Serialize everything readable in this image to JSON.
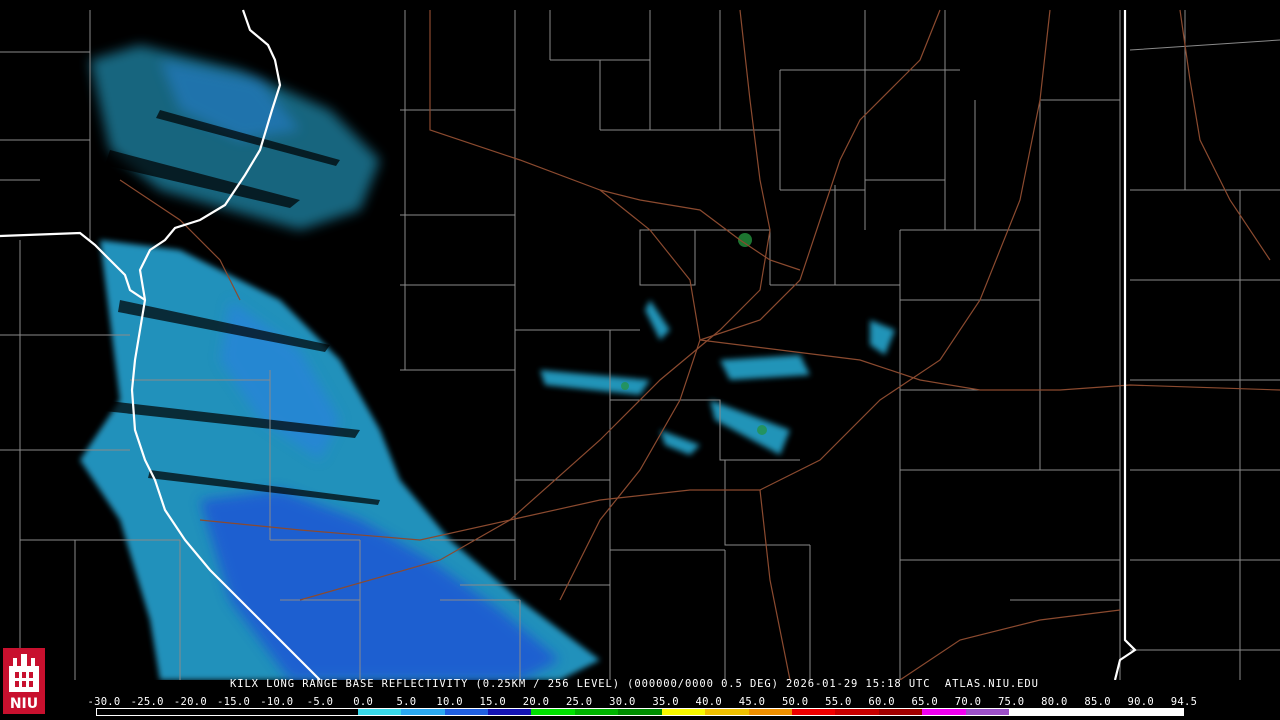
{
  "map": {
    "radar_site": "KILX",
    "product": "LONG RANGE BASE REFLECTIVITY",
    "state_border_color": "#ffffff",
    "county_line_color": "#8a8a8a",
    "highway_color": "#8b4a2f"
  },
  "title_text": "KILX LONG RANGE BASE REFLECTIVITY (0.25KM / 256 LEVEL) (000000/0000 0.5 DEG) 2026-01-29 15:18 UTC  ATLAS.NIU.EDU",
  "colorbar": {
    "labels": [
      "-30.0",
      "-25.0",
      "-20.0",
      "-15.0",
      "-10.0",
      "-5.0",
      "0.0",
      "5.0",
      "10.0",
      "15.0",
      "20.0",
      "25.0",
      "30.0",
      "35.0",
      "40.0",
      "45.0",
      "50.0",
      "55.0",
      "60.0",
      "65.0",
      "70.0",
      "75.0",
      "80.0",
      "85.0",
      "90.0",
      "94.5"
    ],
    "colors": [
      "#000000",
      "#000000",
      "#000000",
      "#000000",
      "#000000",
      "#000000",
      "#38d8e8",
      "#2aa8f0",
      "#1f5fe0",
      "#1414b4",
      "#00e000",
      "#00b400",
      "#008c00",
      "#f8f800",
      "#f0c000",
      "#f09000",
      "#f00000",
      "#c80000",
      "#a00000",
      "#f000f0",
      "#9c50c8",
      "#ffffff",
      "#ffffff",
      "#ffffff",
      "#ffffff"
    ]
  },
  "logo": {
    "text": "NIU",
    "color": "#c8102e"
  }
}
